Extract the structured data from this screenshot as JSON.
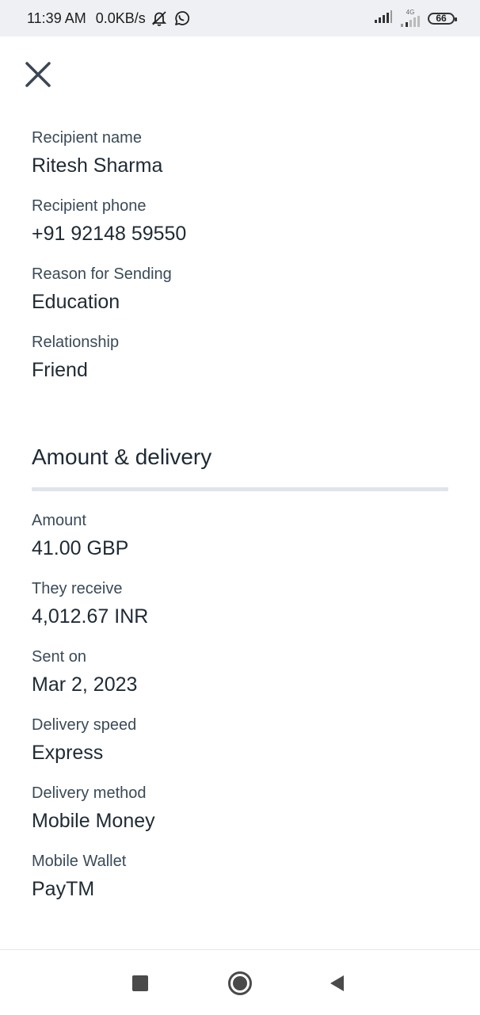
{
  "status_bar": {
    "time": "11:39 AM",
    "speed": "0.0KB/s",
    "network": "4G",
    "battery": "66",
    "icons": [
      "mute-bell-icon",
      "whatsapp-icon",
      "signal-icon",
      "lte-signal-icon",
      "battery-icon"
    ]
  },
  "header": {
    "close_icon": "close-icon"
  },
  "recipient": [
    {
      "label": "Recipient name",
      "value": "Ritesh Sharma"
    },
    {
      "label": "Recipient phone",
      "value": "+91 92148 59550"
    },
    {
      "label": "Reason for Sending",
      "value": "Education"
    },
    {
      "label": "Relationship",
      "value": "Friend"
    }
  ],
  "amount_section": {
    "title": "Amount & delivery",
    "fields": [
      {
        "label": "Amount",
        "value": "41.00 GBP"
      },
      {
        "label": "They receive",
        "value": "4,012.67 INR"
      },
      {
        "label": "Sent on",
        "value": "Mar 2, 2023"
      },
      {
        "label": "Delivery speed",
        "value": "Express"
      },
      {
        "label": "Delivery method",
        "value": "Mobile Money"
      },
      {
        "label": "Mobile Wallet",
        "value": "PayTM"
      }
    ]
  },
  "nav_bar": {
    "icons": [
      "recents-square-icon",
      "home-circle-icon",
      "back-triangle-icon"
    ]
  }
}
